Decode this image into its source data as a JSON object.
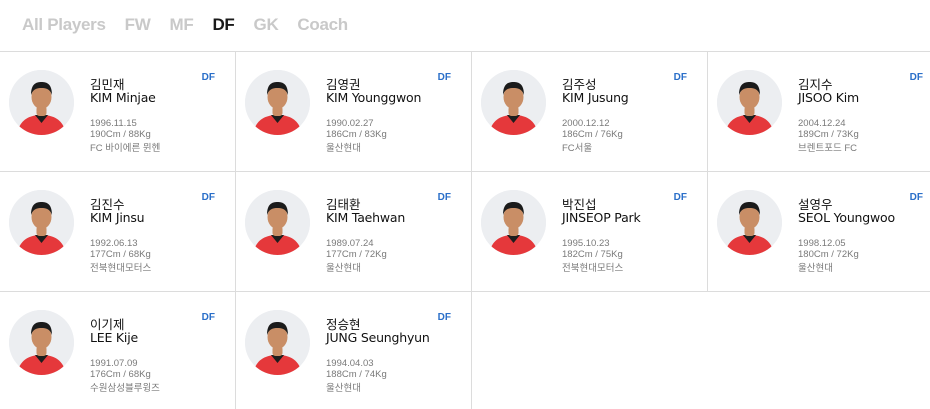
{
  "tabs": [
    {
      "label": "All Players",
      "active": false
    },
    {
      "label": "FW",
      "active": false
    },
    {
      "label": "MF",
      "active": false
    },
    {
      "label": "DF",
      "active": true
    },
    {
      "label": "GK",
      "active": false
    },
    {
      "label": "Coach",
      "active": false
    }
  ],
  "colors": {
    "accent": "#2a6fc9",
    "kit_red": "#e5383b",
    "skin": "#c98e66",
    "hair": "#1b1b1b"
  },
  "players": [
    {
      "name_ko": "김민재",
      "name_en": "KIM Minjae",
      "position": "DF",
      "birth": "1996.11.15",
      "body": "190Cm / 88Kg",
      "club": "FC 바이에른 뮌헨",
      "icon": "player-photo"
    },
    {
      "name_ko": "김영권",
      "name_en": "KIM Younggwon",
      "position": "DF",
      "birth": "1990.02.27",
      "body": "186Cm / 83Kg",
      "club": "울산현대",
      "icon": "player-photo"
    },
    {
      "name_ko": "김주성",
      "name_en": "KIM Jusung",
      "position": "DF",
      "birth": "2000.12.12",
      "body": "186Cm / 76Kg",
      "club": "FC서울",
      "icon": "player-photo"
    },
    {
      "name_ko": "김지수",
      "name_en": "JISOO Kim",
      "position": "DF",
      "birth": "2004.12.24",
      "body": "189Cm / 73Kg",
      "club": "브렌트포드 FC",
      "icon": "player-photo"
    },
    {
      "name_ko": "김진수",
      "name_en": "KIM Jinsu",
      "position": "DF",
      "birth": "1992.06.13",
      "body": "177Cm / 68Kg",
      "club": "전북현대모터스",
      "icon": "player-photo"
    },
    {
      "name_ko": "김태환",
      "name_en": "KIM Taehwan",
      "position": "DF",
      "birth": "1989.07.24",
      "body": "177Cm / 72Kg",
      "club": "울산현대",
      "icon": "player-photo"
    },
    {
      "name_ko": "박진섭",
      "name_en": "JINSEOP Park",
      "position": "DF",
      "birth": "1995.10.23",
      "body": "182Cm / 75Kg",
      "club": "전북현대모터스",
      "icon": "player-photo"
    },
    {
      "name_ko": "설영우",
      "name_en": "SEOL Youngwoo",
      "position": "DF",
      "birth": "1998.12.05",
      "body": "180Cm / 72Kg",
      "club": "울산현대",
      "icon": "player-photo"
    },
    {
      "name_ko": "이기제",
      "name_en": "LEE Kije",
      "position": "DF",
      "birth": "1991.07.09",
      "body": "176Cm / 68Kg",
      "club": "수원삼성블루윙즈",
      "icon": "player-photo"
    },
    {
      "name_ko": "정승현",
      "name_en": "JUNG Seunghyun",
      "position": "DF",
      "birth": "1994.04.03",
      "body": "188Cm / 74Kg",
      "club": "울산현대",
      "icon": "player-photo"
    }
  ]
}
